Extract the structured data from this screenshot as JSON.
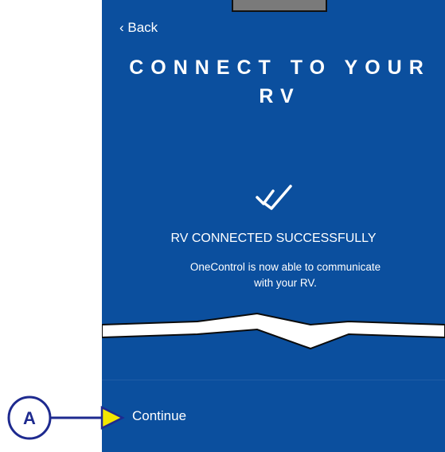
{
  "nav": {
    "back_label": "‹ Back"
  },
  "header": {
    "title_line1": "CONNECT TO YOUR",
    "title_line2": "RV"
  },
  "status": {
    "icon": "double-check-icon",
    "heading": "RV CONNECTED SUCCESSFULLY",
    "description_line1": "OneControl is now able to communicate",
    "description_line2": "with your RV."
  },
  "footer": {
    "continue_label": "Continue"
  },
  "annotation": {
    "callout_letter": "A"
  },
  "colors": {
    "background": "#0b4f9e",
    "text": "#ffffff",
    "callout_arrow": "#1e2a8f",
    "callout_pointer": "#f2e600"
  }
}
